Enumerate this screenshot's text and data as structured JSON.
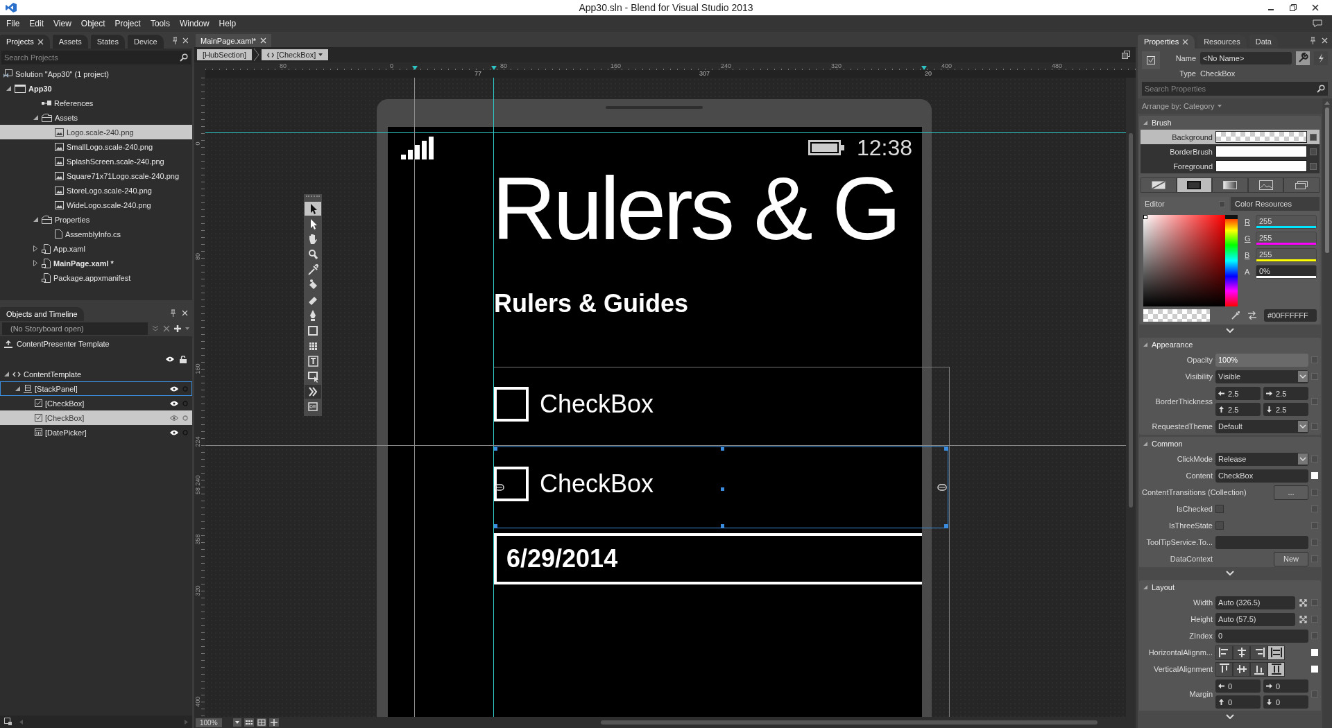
{
  "window": {
    "title": "App30.sln - Blend for Visual Studio 2013"
  },
  "menu": [
    "File",
    "Edit",
    "View",
    "Object",
    "Project",
    "Tools",
    "Window",
    "Help"
  ],
  "projects_panel": {
    "tabs": [
      {
        "label": "Projects",
        "selected": true
      },
      {
        "label": "Assets",
        "selected": false
      },
      {
        "label": "States",
        "selected": false
      },
      {
        "label": "Device",
        "selected": false
      }
    ],
    "search": {
      "placeholder": "Search Projects"
    },
    "tree": [
      {
        "label": "Solution \"App30\" (1 project)",
        "kind": "solution",
        "bold": false,
        "selected": false,
        "children": [
          {
            "label": "App30",
            "kind": "project",
            "bold": true,
            "selected": false,
            "expanded": true,
            "children": [
              {
                "label": "References",
                "kind": "references",
                "bold": false,
                "selected": false
              },
              {
                "label": "Assets",
                "kind": "folder",
                "bold": false,
                "selected": false,
                "expanded": true,
                "children": [
                  {
                    "label": "Logo.scale-240.png",
                    "kind": "image",
                    "bold": false,
                    "selected": true
                  },
                  {
                    "label": "SmallLogo.scale-240.png",
                    "kind": "image",
                    "bold": false,
                    "selected": false
                  },
                  {
                    "label": "SplashScreen.scale-240.png",
                    "kind": "image",
                    "bold": false,
                    "selected": false
                  },
                  {
                    "label": "Square71x71Logo.scale-240.png",
                    "kind": "image",
                    "bold": false,
                    "selected": false
                  },
                  {
                    "label": "StoreLogo.scale-240.png",
                    "kind": "image",
                    "bold": false,
                    "selected": false
                  },
                  {
                    "label": "WideLogo.scale-240.png",
                    "kind": "image",
                    "bold": false,
                    "selected": false
                  }
                ]
              },
              {
                "label": "Properties",
                "kind": "folder",
                "bold": false,
                "selected": false,
                "expanded": true,
                "children": [
                  {
                    "label": "AssemblyInfo.cs",
                    "kind": "file",
                    "bold": false,
                    "selected": false
                  }
                ]
              },
              {
                "label": "App.xaml",
                "kind": "xaml",
                "bold": false,
                "selected": false,
                "expanded": false
              },
              {
                "label": "MainPage.xaml *",
                "kind": "xaml",
                "bold": true,
                "selected": false,
                "expanded": false
              },
              {
                "label": "Package.appxmanifest",
                "kind": "xaml",
                "bold": false,
                "selected": false
              }
            ]
          }
        ]
      }
    ]
  },
  "objects_panel": {
    "title": "Objects and Timeline",
    "storyboard": {
      "placeholder": "(No Storyboard open)"
    },
    "template": "ContentPresenter Template",
    "tree": [
      {
        "label": "ContentTemplate",
        "kind": "template",
        "selected": false,
        "focused": false,
        "expanded": true,
        "children": [
          {
            "label": "[StackPanel]",
            "kind": "stackpanel",
            "selected": false,
            "focused": true,
            "expanded": true,
            "children": [
              {
                "label": "[CheckBox]",
                "kind": "checkbox",
                "selected": false,
                "focused": false
              },
              {
                "label": "[CheckBox]",
                "kind": "checkbox",
                "selected": true,
                "focused": false
              },
              {
                "label": "[DatePicker]",
                "kind": "datepicker",
                "selected": false,
                "focused": false
              }
            ]
          }
        ]
      }
    ]
  },
  "document": {
    "tab": "MainPage.xaml*",
    "breadcrumb": [
      "[HubSection]",
      "[CheckBox]"
    ],
    "ruler": {
      "top_labels": [
        "80",
        "0",
        "80",
        "160",
        "240",
        "320",
        "400",
        "480"
      ],
      "measures": [
        "77",
        "307",
        "20"
      ],
      "left_labels": [
        "0",
        "80",
        "160",
        "224",
        "240",
        "58",
        "358",
        "320",
        "400"
      ]
    },
    "artboard": {
      "time": "12:38",
      "title": "Rulers & G",
      "subtitle": "Rulers & Guides",
      "checkboxes": [
        {
          "label": "CheckBox",
          "checked": false,
          "selected": false
        },
        {
          "label": "CheckBox",
          "checked": false,
          "selected": true
        }
      ],
      "date": "6/29/2014"
    },
    "zoom": "100%"
  },
  "properties": {
    "tabs": [
      {
        "label": "Properties",
        "selected": true
      },
      {
        "label": "Resources",
        "selected": false
      },
      {
        "label": "Data",
        "selected": false
      }
    ],
    "name_label": "Name",
    "name": "<No Name>",
    "type_label": "Type",
    "type": "CheckBox",
    "search": {
      "placeholder": "Search Properties"
    },
    "arrange": "Arrange by: Category",
    "brush": {
      "title": "Brush",
      "rows": [
        {
          "label": "Background",
          "kind": "transparent",
          "selected": true
        },
        {
          "label": "BorderBrush",
          "kind": "solid",
          "color": "#ffffff",
          "selected": false
        },
        {
          "label": "Foreground",
          "kind": "solid",
          "color": "#ffffff",
          "selected": false
        }
      ],
      "types": [
        {
          "kind": "none",
          "selected": false
        },
        {
          "kind": "solid",
          "selected": true
        },
        {
          "kind": "gradient",
          "selected": false
        },
        {
          "kind": "image",
          "selected": false
        },
        {
          "kind": "resource",
          "selected": false
        }
      ],
      "editor_tabs": [
        {
          "label": "Editor",
          "selected": true
        },
        {
          "label": "Color Resources",
          "selected": false
        }
      ],
      "channels": [
        {
          "label": "R",
          "value": "255",
          "level": 1,
          "color": "#00e5ff"
        },
        {
          "label": "G",
          "value": "255",
          "level": 1,
          "color": "#ff00ff"
        },
        {
          "label": "B",
          "value": "255",
          "level": 1,
          "color": "#ffff00"
        },
        {
          "label": "A",
          "value": "0%",
          "level": 0,
          "color": "#ffffff"
        }
      ],
      "hue": {
        "level": 1
      },
      "hex": "#00FFFFFF"
    },
    "sections": [
      {
        "title": "Appearance",
        "more": false,
        "rows": [
          {
            "label": "Opacity",
            "kind": "text",
            "value": "100%",
            "set": false
          },
          {
            "label": "Visibility",
            "kind": "dropdown",
            "value": "Visible",
            "set": false
          },
          {
            "label": "BorderThickness",
            "kind": "thickness",
            "values": [
              "2.5",
              "2.5",
              "2.5",
              "2.5"
            ],
            "set": false
          },
          {
            "label": "RequestedTheme",
            "kind": "dropdown",
            "value": "Default",
            "set": false
          }
        ]
      },
      {
        "title": "Common",
        "more": true,
        "rows": [
          {
            "label": "ClickMode",
            "kind": "dropdown",
            "value": "Release",
            "set": false
          },
          {
            "label": "Content",
            "kind": "text",
            "value": "CheckBox",
            "set": true
          },
          {
            "label": "ContentTransitions (Collection)",
            "kind": "button",
            "value": "...",
            "set": false
          },
          {
            "label": "IsChecked",
            "kind": "checkbox",
            "checked": false,
            "set": false
          },
          {
            "label": "IsThreeState",
            "kind": "checkbox",
            "checked": false,
            "set": false
          },
          {
            "label": "ToolTipService.To...",
            "kind": "text",
            "set": false
          },
          {
            "label": "DataContext",
            "kind": "button",
            "value": "New",
            "set": false
          }
        ]
      },
      {
        "title": "Layout",
        "more": true,
        "rows": [
          {
            "label": "Width",
            "kind": "auto",
            "value": "Auto (326.5)",
            "set": false
          },
          {
            "label": "Height",
            "kind": "auto",
            "value": "Auto (57.5)",
            "set": false
          },
          {
            "label": "ZIndex",
            "kind": "text",
            "value": "0",
            "set": false
          },
          {
            "label": "HorizontalAlignm...",
            "kind": "halign",
            "options": [
              {
                "selected": false
              },
              {
                "selected": false
              },
              {
                "selected": false
              },
              {
                "selected": true
              }
            ],
            "set": true
          },
          {
            "label": "VerticalAlignment",
            "kind": "valign",
            "options": [
              {
                "selected": false
              },
              {
                "selected": false
              },
              {
                "selected": false
              },
              {
                "selected": true
              }
            ],
            "set": true
          },
          {
            "label": "Margin",
            "kind": "thickness",
            "values": [
              "0",
              "0",
              "0",
              "0"
            ],
            "set": false
          }
        ]
      }
    ]
  }
}
